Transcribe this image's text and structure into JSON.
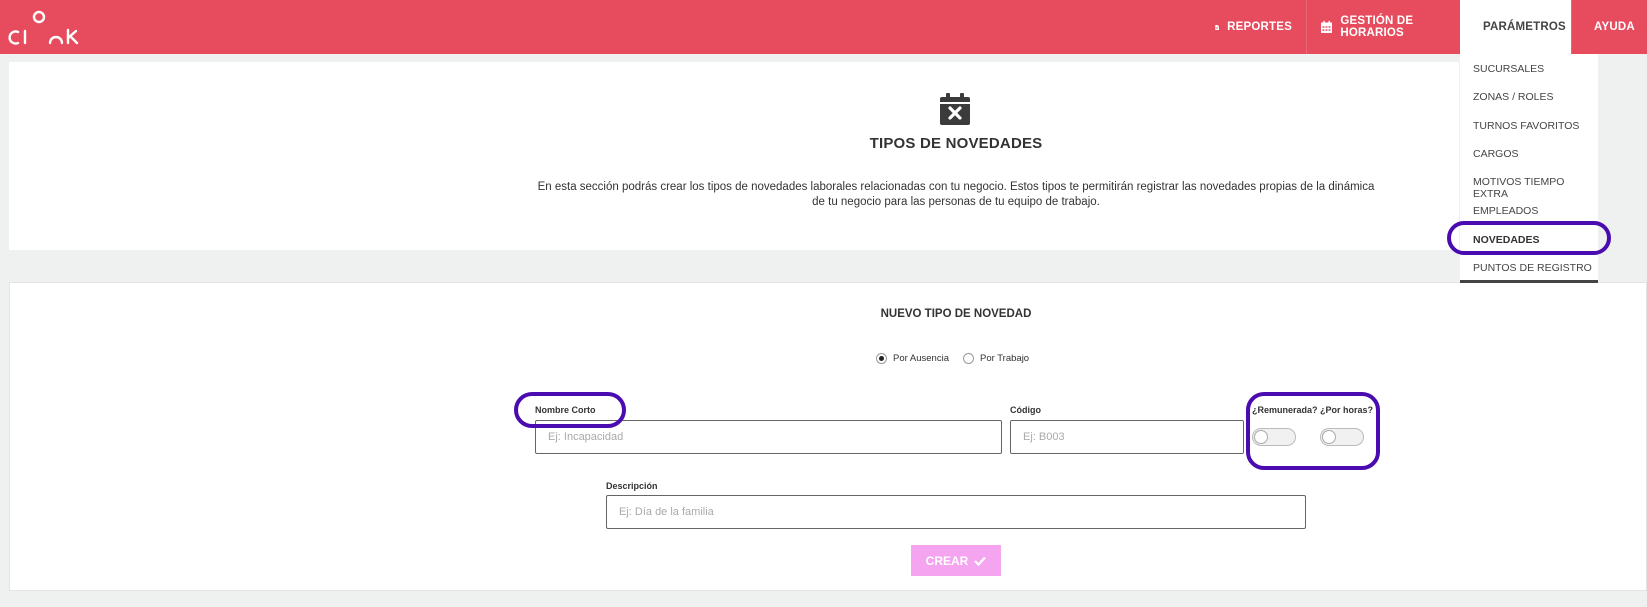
{
  "header": {
    "logo_alt": "clock",
    "nav": [
      {
        "label": "REPORTES",
        "icon": "document-icon"
      },
      {
        "label": "GESTIÓN DE HORARIOS",
        "icon": "calendar-icon"
      },
      {
        "label": "PARÁMETROS",
        "icon": "gears-icon"
      },
      {
        "label": "AYUDA",
        "icon": "help-icon"
      }
    ]
  },
  "dropdown": {
    "items": [
      "SUCURSALES",
      "ZONAS / ROLES",
      "TURNOS FAVORITOS",
      "CARGOS",
      "MOTIVOS TIEMPO EXTRA",
      "EMPLEADOS",
      "NOVEDADES",
      "PUNTOS DE REGISTRO"
    ],
    "selected": "NOVEDADES"
  },
  "section": {
    "title": "TIPOS DE NOVEDADES",
    "description": "En esta sección podrás crear los tipos de novedades laborales relacionadas con tu negocio. Estos tipos te permitirán registrar las novedades propias de la dinámica de tu negocio para las personas de tu equipo de trabajo."
  },
  "form": {
    "title": "NUEVO TIPO DE NOVEDAD",
    "radio_options": [
      "Por Ausencia",
      "Por Trabajo"
    ],
    "radio_selected": "Por Ausencia",
    "nombre_label": "Nombre Corto",
    "nombre_placeholder": "Ej: Incapacidad",
    "codigo_label": "Código",
    "codigo_placeholder": "Ej: B003",
    "remunerada_label": "¿Remunerada?",
    "remunerada_value": false,
    "porhoras_label": "¿Por horas?",
    "porhoras_value": false,
    "descripcion_label": "Descripción",
    "descripcion_placeholder": "Ej: Día de la familia",
    "submit_label": "CREAR"
  },
  "colors": {
    "topbar": "#e74c5e",
    "highlight": "#4a0bb0",
    "button": "#f5a5f0"
  }
}
